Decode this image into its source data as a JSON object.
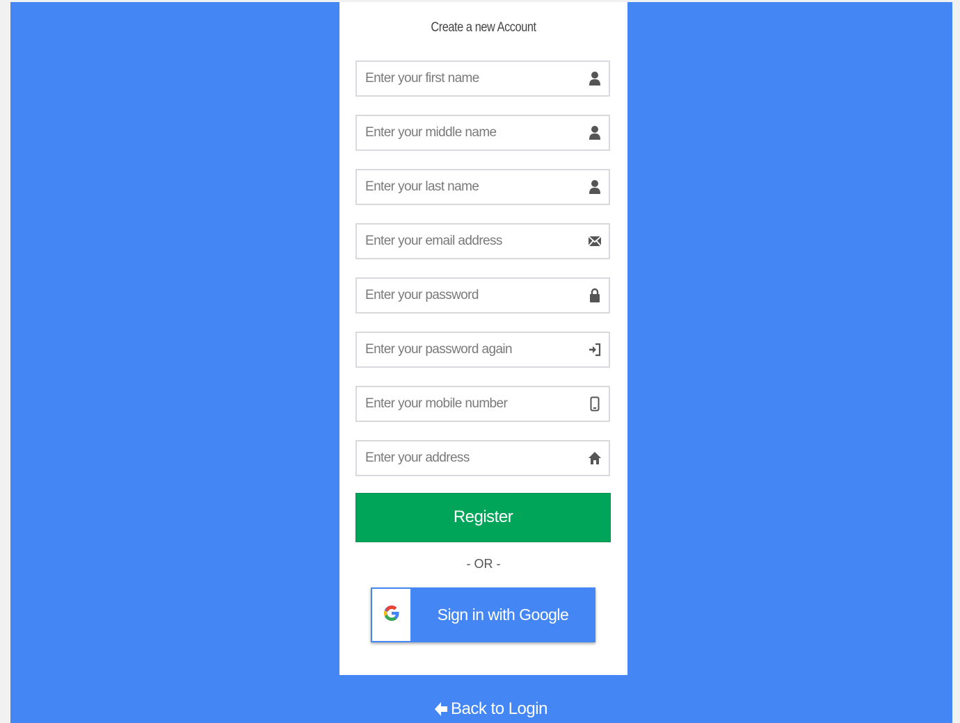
{
  "form": {
    "title": "Create a new Account",
    "fields": [
      {
        "placeholder": "Enter your first name",
        "value": "",
        "icon": "user-icon"
      },
      {
        "placeholder": "Enter your middle name",
        "value": "",
        "icon": "user-icon"
      },
      {
        "placeholder": "Enter your last name",
        "value": "",
        "icon": "user-icon"
      },
      {
        "placeholder": "Enter your email address",
        "value": "",
        "icon": "envelope-icon"
      },
      {
        "placeholder": "Enter your password",
        "value": "",
        "icon": "lock-icon"
      },
      {
        "placeholder": "Enter your password again",
        "value": "",
        "icon": "sign-in-icon"
      },
      {
        "placeholder": "Enter your mobile number",
        "value": "",
        "icon": "mobile-phone-icon"
      },
      {
        "placeholder": "Enter your address",
        "value": "",
        "icon": "home-icon"
      }
    ],
    "register_label": "Register",
    "divider_text": "- OR -",
    "google_label": "Sign in with Google"
  },
  "footer": {
    "back_label": "Back to Login"
  },
  "colors": {
    "background": "#4486f4",
    "register": "#00a55a",
    "google_button": "#4486f4"
  }
}
